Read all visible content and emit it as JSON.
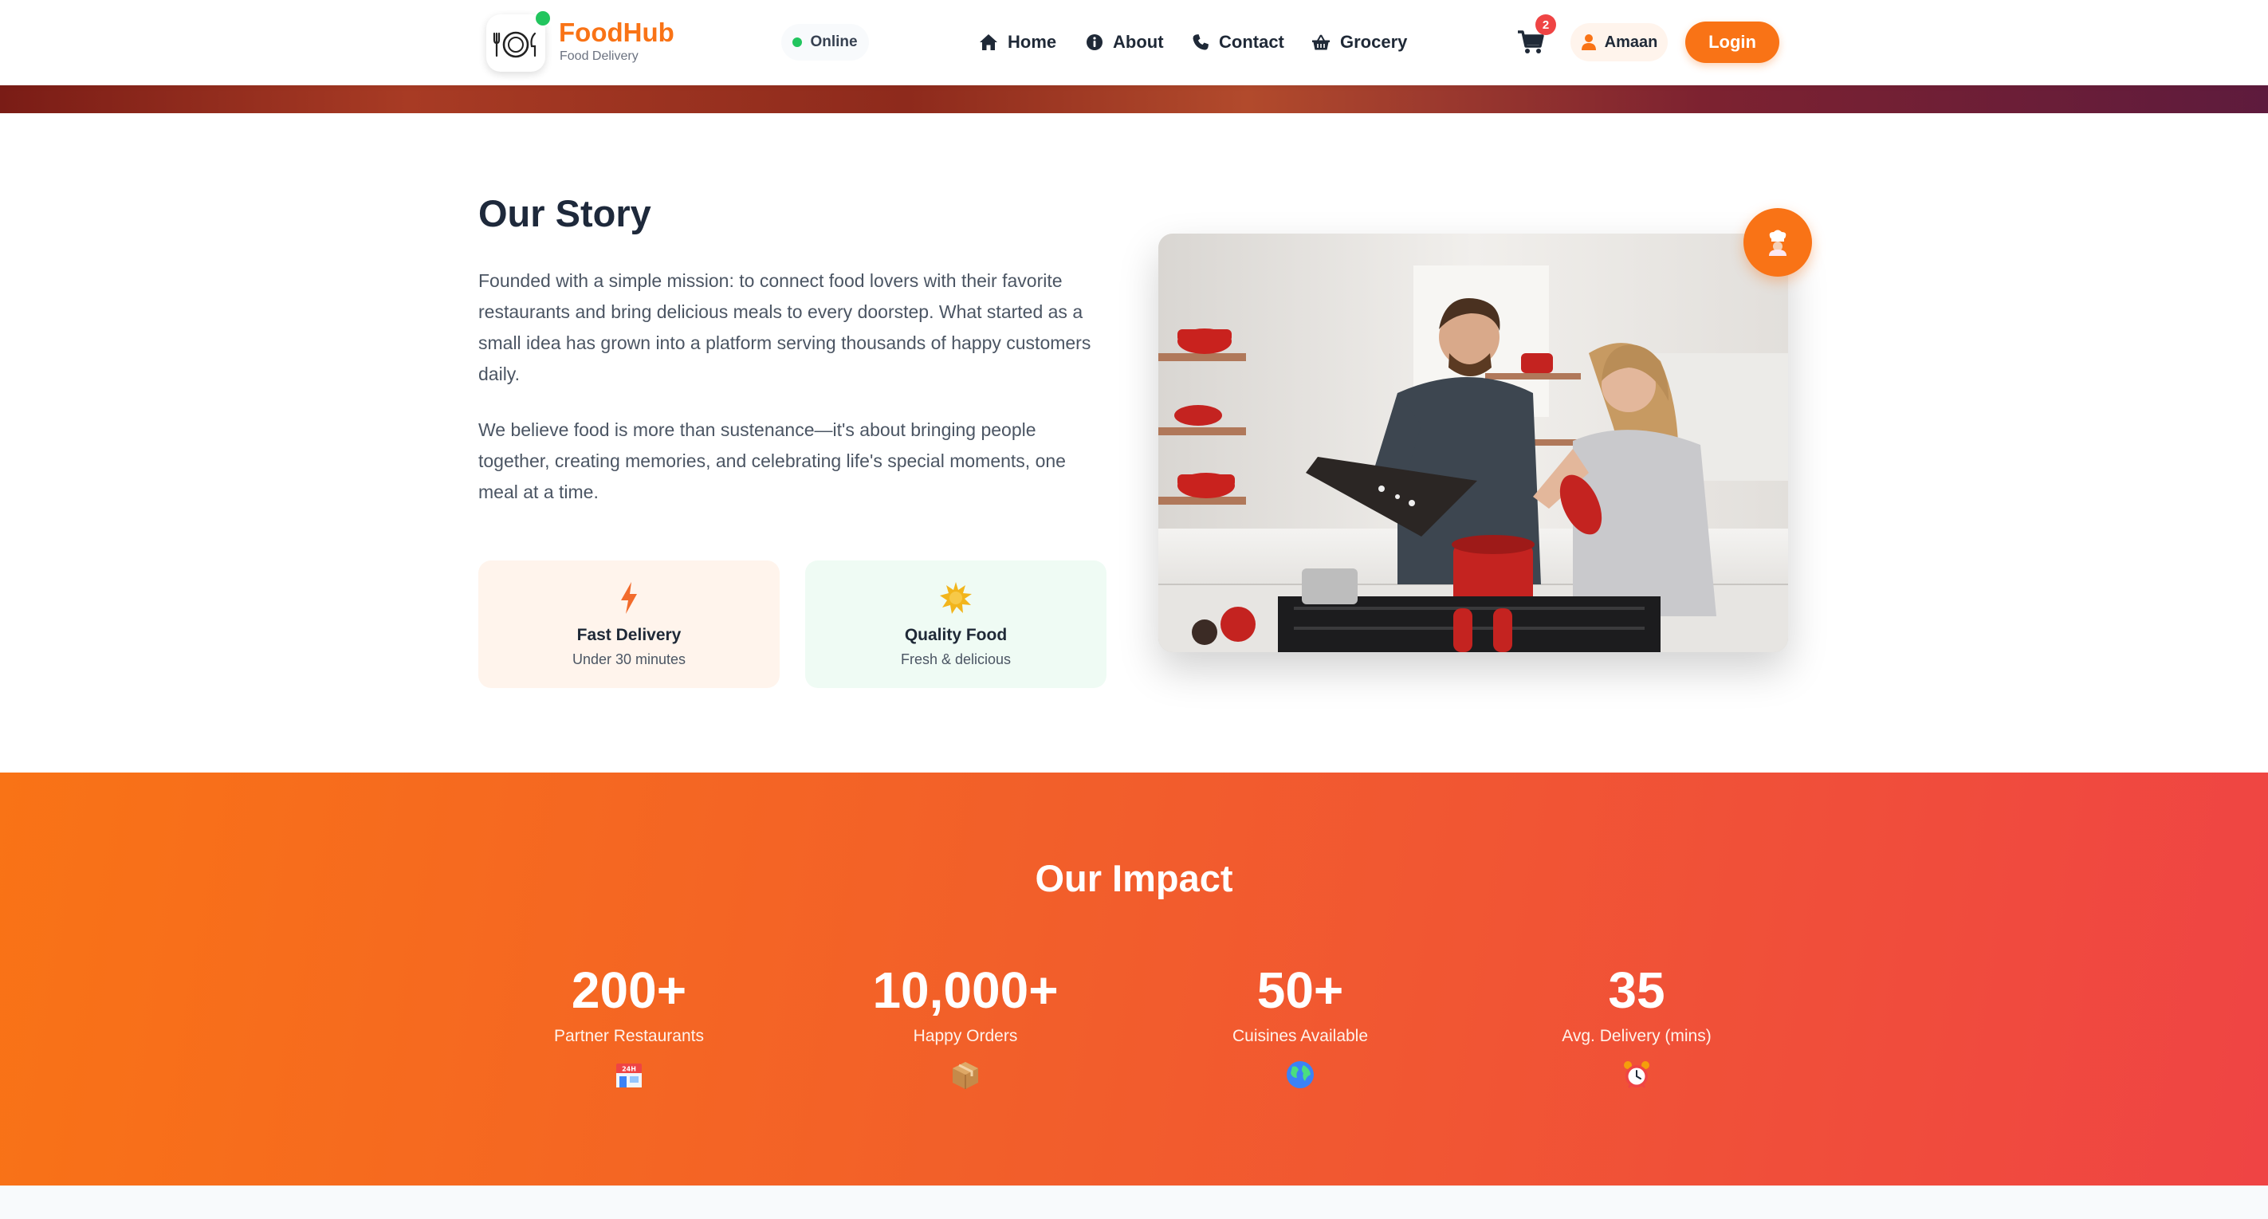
{
  "header": {
    "brand": "FoodHub",
    "tagline": "Food Delivery",
    "status": "Online",
    "nav": [
      {
        "label": "Home",
        "icon": "home-icon"
      },
      {
        "label": "About",
        "icon": "info-icon"
      },
      {
        "label": "Contact",
        "icon": "phone-icon"
      },
      {
        "label": "Grocery",
        "icon": "basket-icon"
      }
    ],
    "cart_count": "2",
    "user_name": "Amaan",
    "login_label": "Login"
  },
  "story": {
    "title": "Our Story",
    "paragraphs": [
      "Founded with a simple mission: to connect food lovers with their favorite restaurants and bring delicious meals to every doorstep. What started as a small idea has grown into a platform serving thousands of happy customers daily.",
      "We believe food is more than sustenance—it's about bringing people together, creating memories, and celebrating life's special moments, one meal at a time."
    ],
    "features": [
      {
        "title": "Fast Delivery",
        "subtitle": "Under 30 minutes",
        "icon": "lightning-icon"
      },
      {
        "title": "Quality Food",
        "subtitle": "Fresh & delicious",
        "icon": "sparkle-icon"
      }
    ]
  },
  "impact": {
    "title": "Our Impact",
    "stats": [
      {
        "value": "200+",
        "label": "Partner Restaurants",
        "icon": "store-24h-icon"
      },
      {
        "value": "10,000+",
        "label": "Happy Orders",
        "icon": "package-icon"
      },
      {
        "value": "50+",
        "label": "Cuisines Available",
        "icon": "globe-icon"
      },
      {
        "value": "35",
        "label": "Avg. Delivery (mins)",
        "icon": "alarm-clock-icon"
      }
    ]
  },
  "colors": {
    "accent": "#f97316",
    "accent_end": "#ef4444",
    "online": "#22c55e",
    "fast_card_bg": "#fff4ec",
    "quality_card_bg": "#effbf4"
  }
}
